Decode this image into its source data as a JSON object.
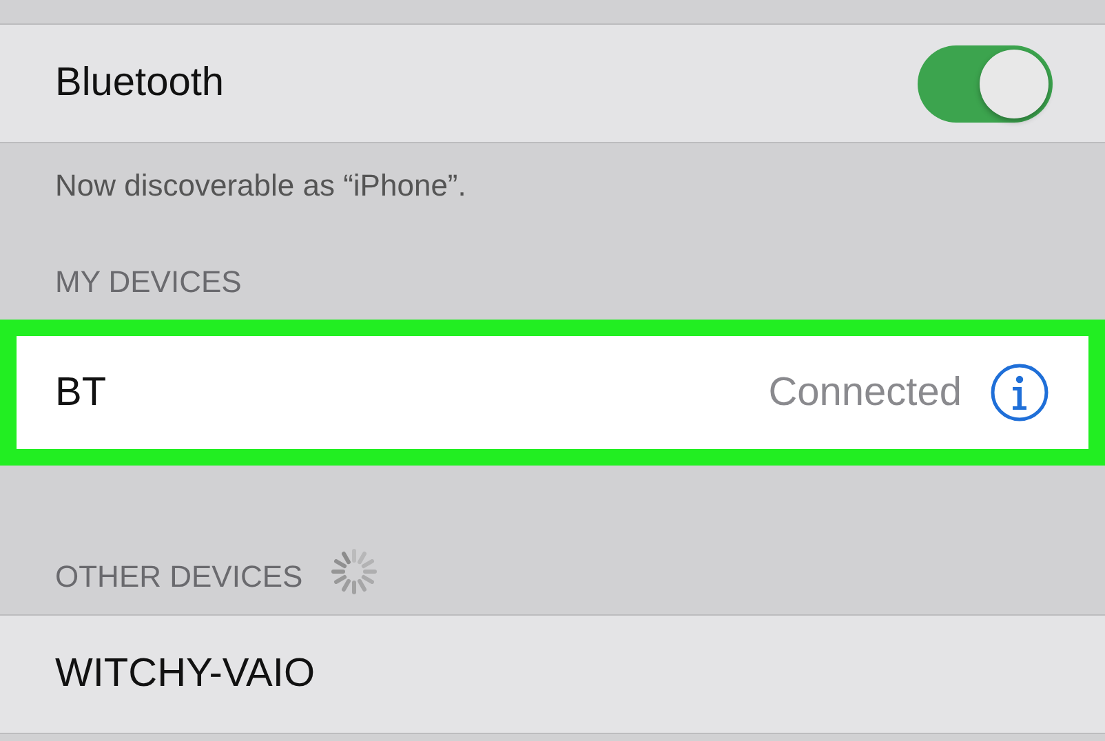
{
  "bluetooth": {
    "label": "Bluetooth",
    "on": true
  },
  "discoverable_note": "Now discoverable as “iPhone”.",
  "my_devices": {
    "header": "MY DEVICES",
    "items": [
      {
        "name": "BT",
        "status": "Connected",
        "highlighted": true
      }
    ]
  },
  "other_devices": {
    "header": "OTHER DEVICES",
    "searching": true,
    "items": [
      {
        "name": "WITCHY-VAIO"
      }
    ]
  }
}
